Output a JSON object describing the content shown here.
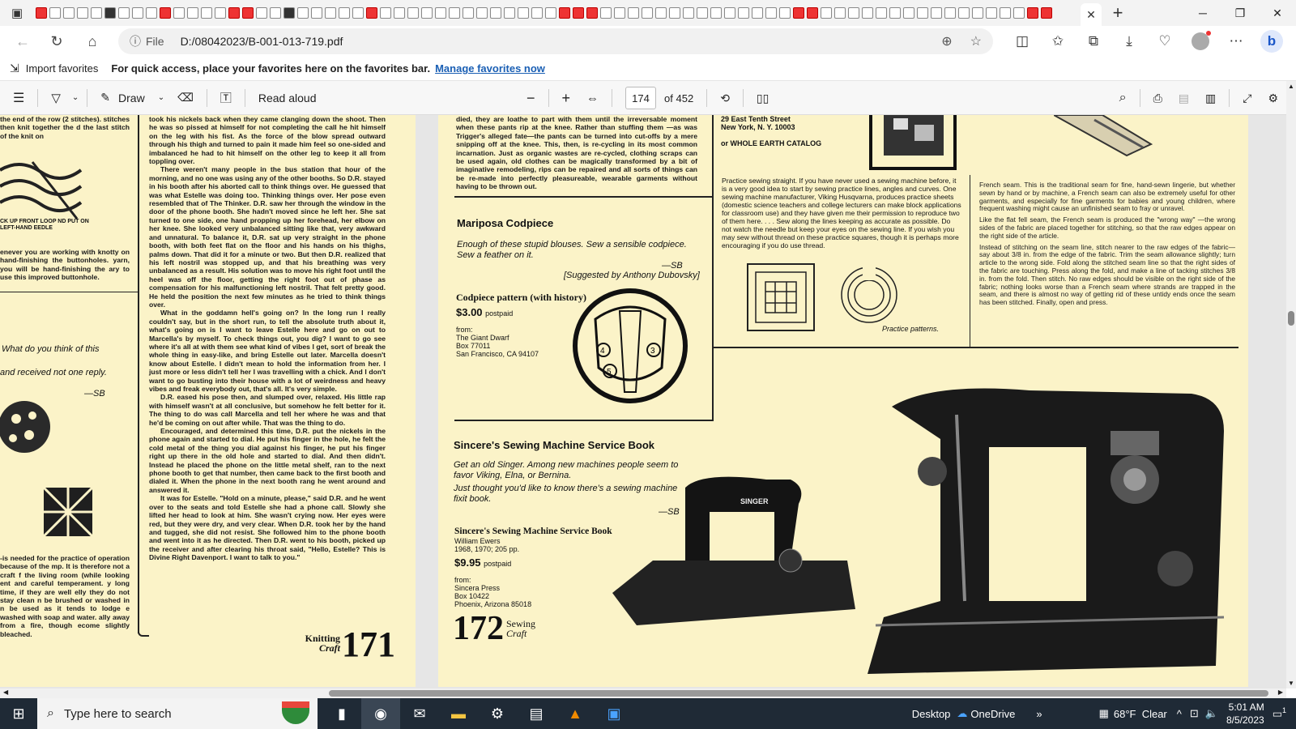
{
  "tabbar": {
    "active_tab_close": "✕",
    "new_tab": "+",
    "window_controls": [
      "─",
      "❐",
      "✕"
    ]
  },
  "address": {
    "scheme": "File",
    "url": "D:/08042023/B-001-013-719.pdf"
  },
  "favorites_bar": {
    "import_label": "Import favorites",
    "message": "For quick access, place your favorites here on the favorites bar.",
    "link": "Manage favorites now"
  },
  "pdf_toolbar": {
    "draw_label": "Draw",
    "read_aloud_label": "Read aloud",
    "page_number": "174",
    "page_total": "of 452",
    "zoom_out": "−",
    "zoom_in": "+"
  },
  "left_page": {
    "left_col_top": "the end of the row (2 stitches). stitches then knit together the d the last stitch of the knit on",
    "diagram_label": "CK UP FRONT LOOP ND PUT ON LEFT-HAND EEDLE",
    "left_col_mid": "enever you are working with knotty on hand-finishing the buttonholes. yarn, you will be hand-finishing the ary to use this improved buttonhole.",
    "quote1": "What do you think of this",
    "quote2": "and received not one reply.",
    "sig": "—SB",
    "left_col_bottom": "-is needed for the practice of operation because of the mp. It is therefore not a craft f the living room (while looking ent and careful temperament. y long time, if they are well elly they do not stay clean n be brushed or washed in n be used as it tends to lodge e washed with soap and water. ally away from a fire, though ecome slightly bleached.",
    "story_p1": "took his nickels back when they came clanging down the shoot. Then he was so pissed at himself for not completing the call he hit himself on the leg with his fist. As the force of the blow spread outward through his thigh and turned to pain it made him feel so one-sided and imbalanced he had to hit himself on the other leg to keep it all from toppling over.",
    "story_p2": "There weren't many people in the bus station that hour of the morning, and no one was using any of the other booths. So D.R. stayed in his booth after his aborted call to think things over. He guessed that was what Estelle was doing too. Thinking things over. Her pose even resembled that of The Thinker. D.R. saw her through the window in the door of the phone booth. She hadn't moved since he left her. She sat turned to one side, one hand propping up her forehead, her elbow on her knee. She looked very unbalanced sitting like that, very awkward and unnatural. To balance it, D.R. sat up very straight in the phone booth, with both feet flat on the floor and his hands on his thighs, palms down. That did it for a minute or two. But then D.R. realized that his left nostril was stopped up, and that his breathing was very unbalanced as a result. His solution was to move his right foot until the heel was off the floor, getting the right foot out of phase as compensation for his malfunctioning left nostril. That felt pretty good. He held the position the next few minutes as he tried to think things over.",
    "story_p3": "What in the goddamn hell's going on? In the long run I really couldn't say, but in the short run, to tell the absolute truth about it, what's going on is I want to leave Estelle here and go on out to Marcella's by myself. To check things out, you dig? I want to go see where it's all at with them see what kind of vibes I get, sort of break the whole thing in easy-like, and bring Estelle out later. Marcella doesn't know about Estelle. I didn't mean to hold the information from her. I just more or less didn't tell her I was travelling with a chick. And I don't want to go busting into their house with a lot of weirdness and heavy vibes and freak everybody out, that's all. It's very simple.",
    "story_p4": "D.R. eased his pose then, and slumped over, relaxed. His little rap with himself wasn't at all conclusive, but somehow he felt better for it. The thing to do was call Marcella and tell her where he was and that he'd be coming on out after while. That was the thing to do.",
    "story_p5": "Encouraged, and determined this time, D.R. put the nickels in the phone again and started to dial. He put his finger in the hole, he felt the cold metal of the thing you dial against his finger, he put his finger right up there in the old hole and started to dial. And then didn't. Instead he placed the phone on the little metal shelf, ran to the next phone booth to get that number, then came back to the first booth and dialed it. When the phone in the next booth rang he went around and answered it.",
    "story_p6": "It was for Estelle. \"Hold on a minute, please,\" said D.R. and he went over to the seats and told Estelle she had a phone call. Slowly she lifted her head to look at him. She wasn't crying now. Her eyes were red, but they were dry, and very clear. When D.R. took her by the hand and tugged, she did not resist. She followed him to the phone booth and went into it as he directed. Then D.R. went to his booth, picked up the receiver and after clearing his throat said, \"Hello, Estelle? This is Divine Right Davenport. I want to talk to you.\"",
    "folio_label1": "Knitting",
    "folio_label2": "Craft",
    "folio_number": "171"
  },
  "right_page": {
    "top_col1": "died, they are loathe to part with them until the irreversable moment when these pants rip at the knee. Rather than stuffing them —as was Trigger's alleged fate—the pants can be turned into cut-offs by a mere snipping off at the knee. This, then, is re-cycling in its most common incarnation. Just as organic wastes are re-cycled, clothing scraps can be used again, old clothes can be magically transformed by a bit of imaginative remodeling, rips can be repaired and all sorts of things can be re-made into perfectly pleasureable, wearable garments without having to be thrown out.",
    "address_line1": "29 East Tenth Street",
    "address_line2": "New York, N. Y. 10003",
    "address_or": "or WHOLE EARTH CATALOG",
    "mariposa_title": "Mariposa Codpiece",
    "mariposa_text": "Enough of these stupid blouses. Sew a sensible codpiece. Sew a feather on it.",
    "mariposa_sig": "—SB",
    "mariposa_credit": "[Suggested by Anthony Dubovsky]",
    "codpiece_title": "Codpiece pattern (with history)",
    "codpiece_price": "$3.00",
    "codpiece_postpaid": "postpaid",
    "codpiece_from": "from:",
    "codpiece_addr": [
      "The Giant Dwarf",
      "Box 77011",
      "San Francisco, CA 94107"
    ],
    "practice_text": "Practice sewing straight. If you have never used a sewing machine before, it is a very good idea to start by sewing practice lines, angles and curves. One sewing machine manufacturer, Viking Husqvarna, produces practice sheets (domestic science teachers and college lecturers can make block applications for classroom use) and they have given me their permission to reproduce two of them here. . . . Sew along the lines keeping as accurate as possible. Do not watch the needle but keep your eyes on the sewing line. If you wish you may sew without thread on these practice squares, though it is perhaps more encouraging if you do use thread.",
    "practice_caption": "Practice patterns.",
    "french_p1": "French seam. This is the traditional seam for fine, hand-sewn lingerie, but whether sewn by hand or by machine, a French seam can also be extremely useful for other garments, and especially for fine garments for babies and young children, where frequent washing might cause an unfinished seam to fray or unravel.",
    "french_p2": "Like the flat fell seam, the French seam is produced the \"wrong way\" —the wrong sides of the fabric are placed together for stitching, so that the raw edges appear on the right side of the article.",
    "french_p3": "Instead of stitching on the seam line, stitch nearer to the raw edges of the fabric—say about 3/8 in. from the edge of the fabric. Trim the seam allowance slightly; turn article to the wrong side. Fold along the stitched seam line so that the right sides of the fabric are touching. Press along the fold, and make a line of tacking stitches 3/8 in. from the fold. Then stitch. No raw edges should be visible on the right side of the fabric; nothing looks worse than a French seam where strands are trapped in the seam, and there is almost no way of getting rid of these untidy ends once the seam has been stitched. Finally, open and press.",
    "sincere_title": "Sincere's Sewing Machine Service Book",
    "sincere_text1": "Get an old Singer. Among new machines people seem to favor Viking, Elna, or Bernina.",
    "sincere_text2": "Just thought you'd like to know there's a sewing machine fixit book.",
    "sincere_sig": "—SB",
    "book_title": "Sincere's Sewing Machine Service Book",
    "book_author": "William Ewers",
    "book_pub": "1968, 1970; 205 pp.",
    "book_price": "$9.95",
    "book_postpaid": "postpaid",
    "book_from": "from:",
    "book_addr": [
      "Sincera Press",
      "Box 10422",
      "Phoenix, Arizona 85018"
    ],
    "machine_brand": "SINGER",
    "folio_number": "172",
    "folio_label1": "Sewing",
    "folio_label2": "Craft"
  },
  "taskbar": {
    "search_placeholder": "Type here to search",
    "desktop_label": "Desktop",
    "onedrive_label": "OneDrive",
    "weather": "68°F  Clear",
    "time": "5:01 AM",
    "date": "8/5/2023",
    "notification_count": "1"
  }
}
